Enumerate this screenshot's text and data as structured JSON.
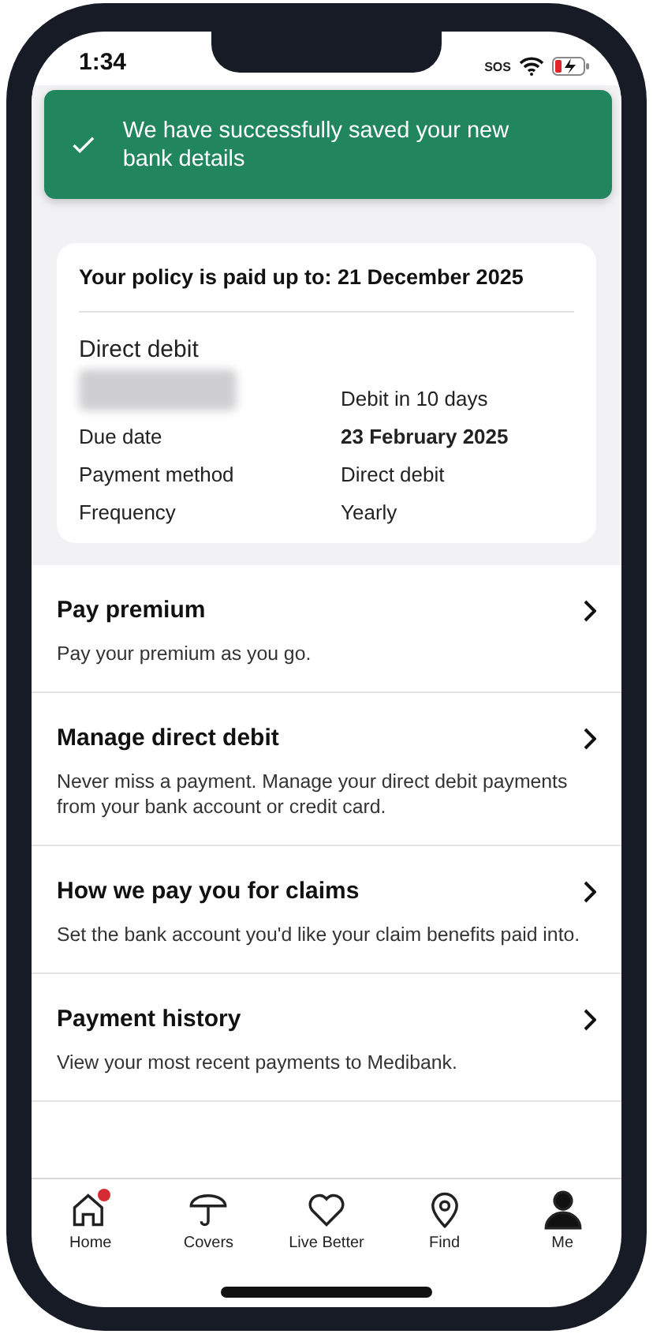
{
  "status_bar": {
    "time": "1:34",
    "sos": "SOS"
  },
  "toast": {
    "message": "We have successfully saved your new bank details"
  },
  "policy_card": {
    "paid_up": "Your policy is paid up to: 21 December 2025",
    "method_title": "Direct debit",
    "debit_note": "Debit in 10 days",
    "rows": [
      {
        "label": "Due date",
        "value": "23 February 2025",
        "emphasis": true
      },
      {
        "label": "Payment method",
        "value": "Direct debit",
        "emphasis": false
      },
      {
        "label": "Frequency",
        "value": "Yearly",
        "emphasis": false
      }
    ]
  },
  "menu_items": [
    {
      "title": "Pay premium",
      "description": "Pay your premium as you go."
    },
    {
      "title": "Manage direct debit",
      "description": "Never miss a payment. Manage your direct debit payments from your bank account or credit card."
    },
    {
      "title": "How we pay you for claims",
      "description": "Set the bank account you'd like your claim benefits paid into."
    },
    {
      "title": "Payment history",
      "description": "View your most recent payments to Medibank."
    }
  ],
  "tab_bar": [
    {
      "label": "Home",
      "selected": false,
      "badge": true
    },
    {
      "label": "Covers",
      "selected": false,
      "badge": false
    },
    {
      "label": "Live Better",
      "selected": false,
      "badge": false
    },
    {
      "label": "Find",
      "selected": false,
      "badge": false
    },
    {
      "label": "Me",
      "selected": true,
      "badge": false
    }
  ]
}
